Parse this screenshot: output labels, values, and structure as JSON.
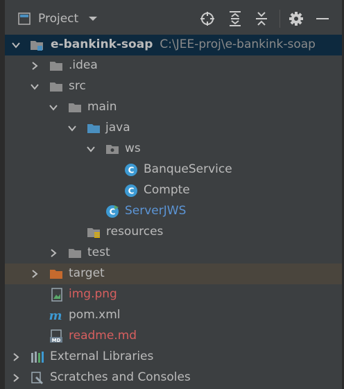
{
  "header": {
    "title": "Project",
    "dropdown_icon": "chevron-down-icon"
  },
  "toolbar": [
    "locate-icon",
    "expand-all-icon",
    "collapse-all-icon",
    "gear-icon",
    "minimize-icon"
  ],
  "tree": {
    "root": {
      "name": "e-bankink-soap",
      "path": "C:\\JEE-proj\\e-bankink-soap"
    },
    "idea": ".idea",
    "src": "src",
    "main": "main",
    "java": "java",
    "ws": "ws",
    "banque_service": "BanqueService",
    "compte": "Compte",
    "server_jws": "ServerJWS",
    "resources": "resources",
    "test": "test",
    "target": "target",
    "img": "img.png",
    "pom": "pom.xml",
    "readme": "readme.md",
    "ext_libs": "External Libraries",
    "scratches": "Scratches and Consoles"
  },
  "colors": {
    "background": "#3c3f41",
    "selected_row": "#0d293e",
    "highlight_row": "#4a453d",
    "folder": "#8c8c8c",
    "source_folder": "#4a8fbf",
    "excluded_folder": "#c56a2e",
    "class_icon": "#3d9ad3",
    "link_blue": "#5c95d6",
    "untracked_red": "#d75f5f"
  },
  "icon_md_text": "MD"
}
